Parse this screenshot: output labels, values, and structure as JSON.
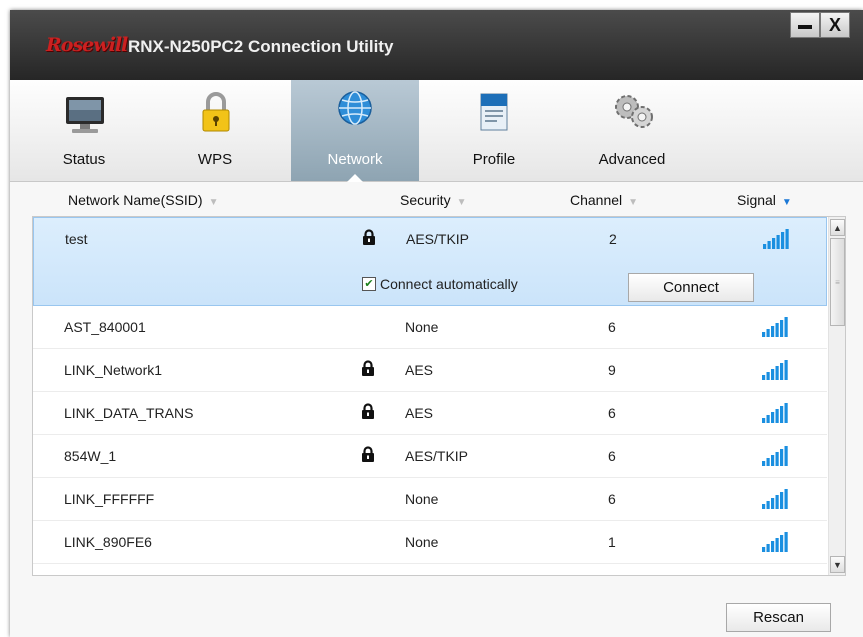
{
  "window": {
    "brand": "Rosewill",
    "title": "RNX-N250PC2 Connection Utility",
    "minimize": "",
    "close": "X"
  },
  "tabs": [
    {
      "label": "Status",
      "icon": "monitor-icon",
      "active": false
    },
    {
      "label": "WPS",
      "icon": "padlock-icon",
      "active": false
    },
    {
      "label": "Network",
      "icon": "globe-icon",
      "active": true
    },
    {
      "label": "Profile",
      "icon": "document-icon",
      "active": false
    },
    {
      "label": "Advanced",
      "icon": "gears-icon",
      "active": false
    }
  ],
  "list_header": {
    "ssid": "Network Name(SSID)",
    "security": "Security",
    "channel": "Channel",
    "signal": "Signal"
  },
  "networks": [
    {
      "ssid": "test",
      "locked": true,
      "security": "AES/TKIP",
      "channel": "2",
      "selected": true
    },
    {
      "ssid": "AST_840001",
      "locked": false,
      "security": "None",
      "channel": "6",
      "selected": false
    },
    {
      "ssid": "LINK_Network1",
      "locked": true,
      "security": "AES",
      "channel": "9",
      "selected": false
    },
    {
      "ssid": "LINK_DATA_TRANS",
      "locked": true,
      "security": "AES",
      "channel": "6",
      "selected": false
    },
    {
      "ssid": "854W_1",
      "locked": true,
      "security": "AES/TKIP",
      "channel": "6",
      "selected": false
    },
    {
      "ssid": "LINK_FFFFFF",
      "locked": false,
      "security": "None",
      "channel": "6",
      "selected": false
    },
    {
      "ssid": "LINK_890FE6",
      "locked": false,
      "security": "None",
      "channel": "1",
      "selected": false
    }
  ],
  "selected_row": {
    "auto_connect_label": "Connect automatically",
    "auto_connect_checked": true,
    "connect_label": "Connect"
  },
  "footer": {
    "rescan_label": "Rescan"
  },
  "colors": {
    "signal": "#1a8fe0",
    "selected_row": "#d4e9fc",
    "active_tab": "#a3b7c4",
    "sort_active": "#1b78d6"
  }
}
